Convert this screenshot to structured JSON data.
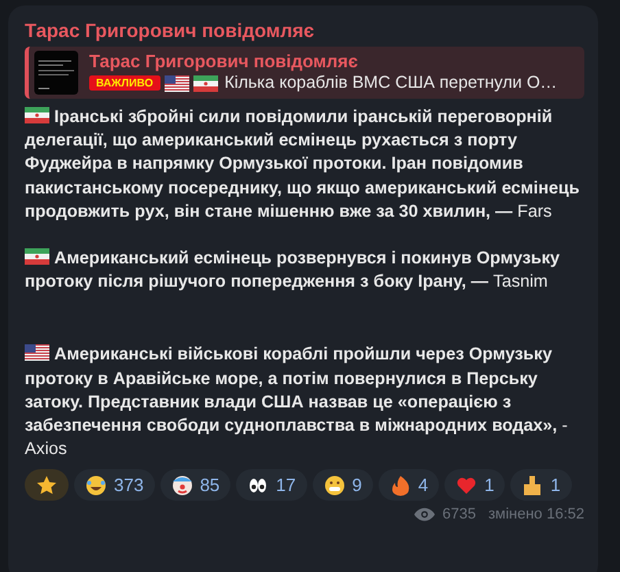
{
  "message": {
    "author": "Тарас Григорович повідомляє",
    "quote": {
      "author": "Тарас Григорович повідомляє",
      "badge": "ВАЖЛИВО",
      "flags": [
        {
          "kind": "usa"
        },
        {
          "kind": "iran"
        }
      ],
      "text": "Кілька кораблів ВМС США перетнули О…"
    },
    "paragraphs": [
      {
        "kind": "iran",
        "text": "**Іранські збройні сили повідомили іранській переговорній делегації, що американський есмінець рухається з порту Фуджейра в напрямку Ормузької протоки. Іран повідомив пакистанському посереднику, що якщо американський есмінець продовжить рух, він стане мішенню вже за 30 хвилин, —** Fars"
      },
      {
        "kind": "iran",
        "text": "**Американський есмінець розвернувся і покинув Ормузьку протоку після рішучого попередження з боку Ірану, —** Tasnim"
      },
      {
        "kind": "usa",
        "text": "**Американські військові кораблі пройшли через Ормузьку протоку в Аравійське море, а потім повернулися в Перську затоку. Представник влади США назвав це «операцією з забезпечення свободи судноплавства в міжнародних водах»,** - Axios"
      }
    ],
    "reactions": [
      {
        "kind": "star",
        "selected": true
      },
      {
        "kind": "laugh",
        "count": "373",
        "selected": false
      },
      {
        "kind": "clown",
        "count": "85",
        "selected": false
      },
      {
        "kind": "eyes",
        "count": "17",
        "selected": false
      },
      {
        "kind": "grin",
        "count": "9",
        "selected": false
      },
      {
        "kind": "fire",
        "count": "4",
        "selected": false
      },
      {
        "kind": "heart",
        "count": "1",
        "selected": false
      },
      {
        "kind": "finger",
        "count": "1",
        "selected": false
      }
    ],
    "views": "6735",
    "edited": "змінено 16:52"
  }
}
